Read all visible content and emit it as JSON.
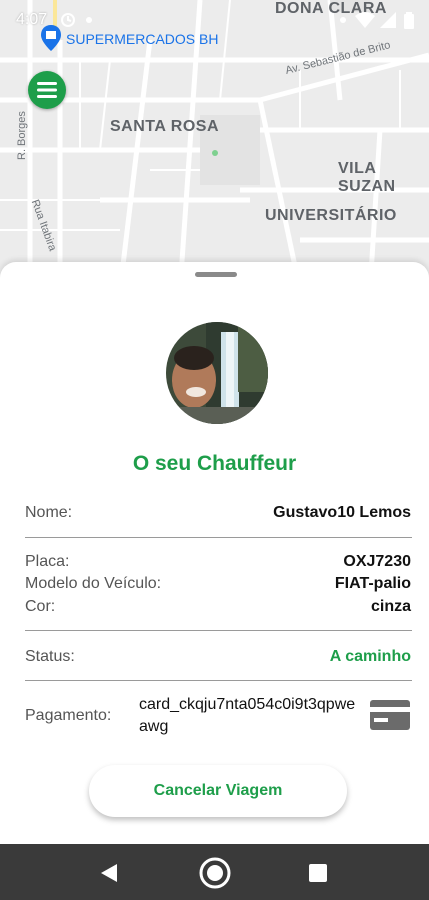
{
  "status_bar": {
    "time": "4:07"
  },
  "map": {
    "labels": {
      "dona_clara": "DONA CLARA",
      "supermercados": "SUPERMERCADOS BH",
      "santa_rosa": "SANTA ROSA",
      "vila_suzana": "VILA SUZAN",
      "universitario": "UNIVERSITÁRIO"
    },
    "streets": {
      "sebastiao": "Av. Sebastião de Brito",
      "borges": "R. Borges",
      "itabira": "Rua Itabira"
    },
    "colors": {
      "background": "#ececec",
      "road": "#ffffff",
      "poi_blue": "#1a73e8"
    }
  },
  "menu_button": {
    "icon": "hamburger-icon",
    "color": "#1e9e4a"
  },
  "sheet": {
    "title": "O seu Chauffeur",
    "driver": {
      "name_label": "Nome:",
      "name_value": "Gustavo10 Lemos"
    },
    "vehicle": {
      "plate_label": "Placa:",
      "plate_value": "OXJ7230",
      "model_label": "Modelo do Veículo:",
      "model_value": "FIAT-palio",
      "color_label": "Cor:",
      "color_value": "cinza"
    },
    "status": {
      "label": "Status:",
      "value": "A caminho"
    },
    "payment": {
      "label": "Pagamento:",
      "value": "card_ckqju7nta054c0i9t3qpweawg",
      "icon": "credit-card-icon"
    },
    "cancel_button": "Cancelar Viagem",
    "accent_color": "#1e9e4a"
  },
  "nav_bar": {
    "back_icon": "back-triangle-icon",
    "home_icon": "home-circle-icon",
    "recents_icon": "recents-square-icon"
  }
}
